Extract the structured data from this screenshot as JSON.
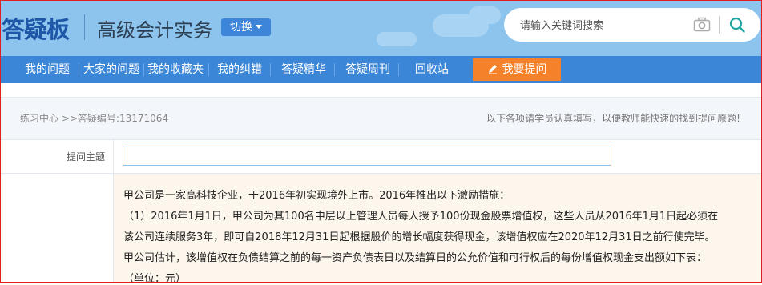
{
  "header": {
    "logo": "答疑板",
    "subject": "高级会计实务",
    "switch_label": "切换",
    "search_placeholder": "请输入关键词搜索",
    "bg_color": "#8cc4ee"
  },
  "nav": {
    "items": [
      "我的问题",
      "大家的问题",
      "我的收藏夹",
      "我的纠错",
      "答疑精华",
      "答疑周刊",
      "回收站"
    ],
    "ask_label": "我要提问",
    "bg_color": "#3b86d6",
    "ask_color": "#f5822a"
  },
  "breadcrumb": {
    "text": "练习中心 >>答疑编号:13171064",
    "notice": "以下各项请学员认真填写，以便教师能快速的找到提问原题!"
  },
  "form": {
    "topic_label": "提问主题",
    "topic_value": "",
    "question_lines": [
      "甲公司是一家高科技企业，于2016年初实现境外上市。2016年推出以下激励措施：",
      "（1）2016年1月1日，甲公司为其100名中层以上管理人员每人授予100份现金股票增值权，这些人员从2016年1月1日起必须在",
      "该公司连续服务3年，即可自2018年12月31日起根据股价的增长幅度获得现金，该增值权应在2020年12月31日之前行使完毕。",
      "甲公司估计，该增值权在负债结算之前的每一资产负债表日以及结算日的公允价值和可行权后的每份增值权现金支出额如下表：",
      "（单位：元）"
    ]
  }
}
